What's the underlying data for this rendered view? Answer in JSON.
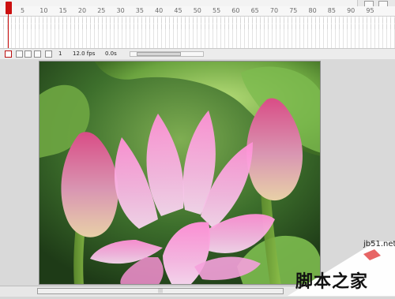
{
  "timeline": {
    "ruler_numbers": [
      "5",
      "10",
      "15",
      "20",
      "25",
      "30",
      "35",
      "40",
      "45",
      "50",
      "55",
      "60",
      "65",
      "70",
      "75",
      "80",
      "85",
      "90",
      "95"
    ],
    "frame_field": "1",
    "fps_field": "12.0 fps",
    "time_field": "0.0s"
  },
  "stage": {
    "image_subject": "pink lotus flowers with buds and green leaves"
  },
  "watermark": {
    "site": "jb51.net",
    "title": "脚本之家"
  },
  "colors": {
    "playhead": "#cc1010",
    "stage_bg": "#d9d9d9"
  }
}
